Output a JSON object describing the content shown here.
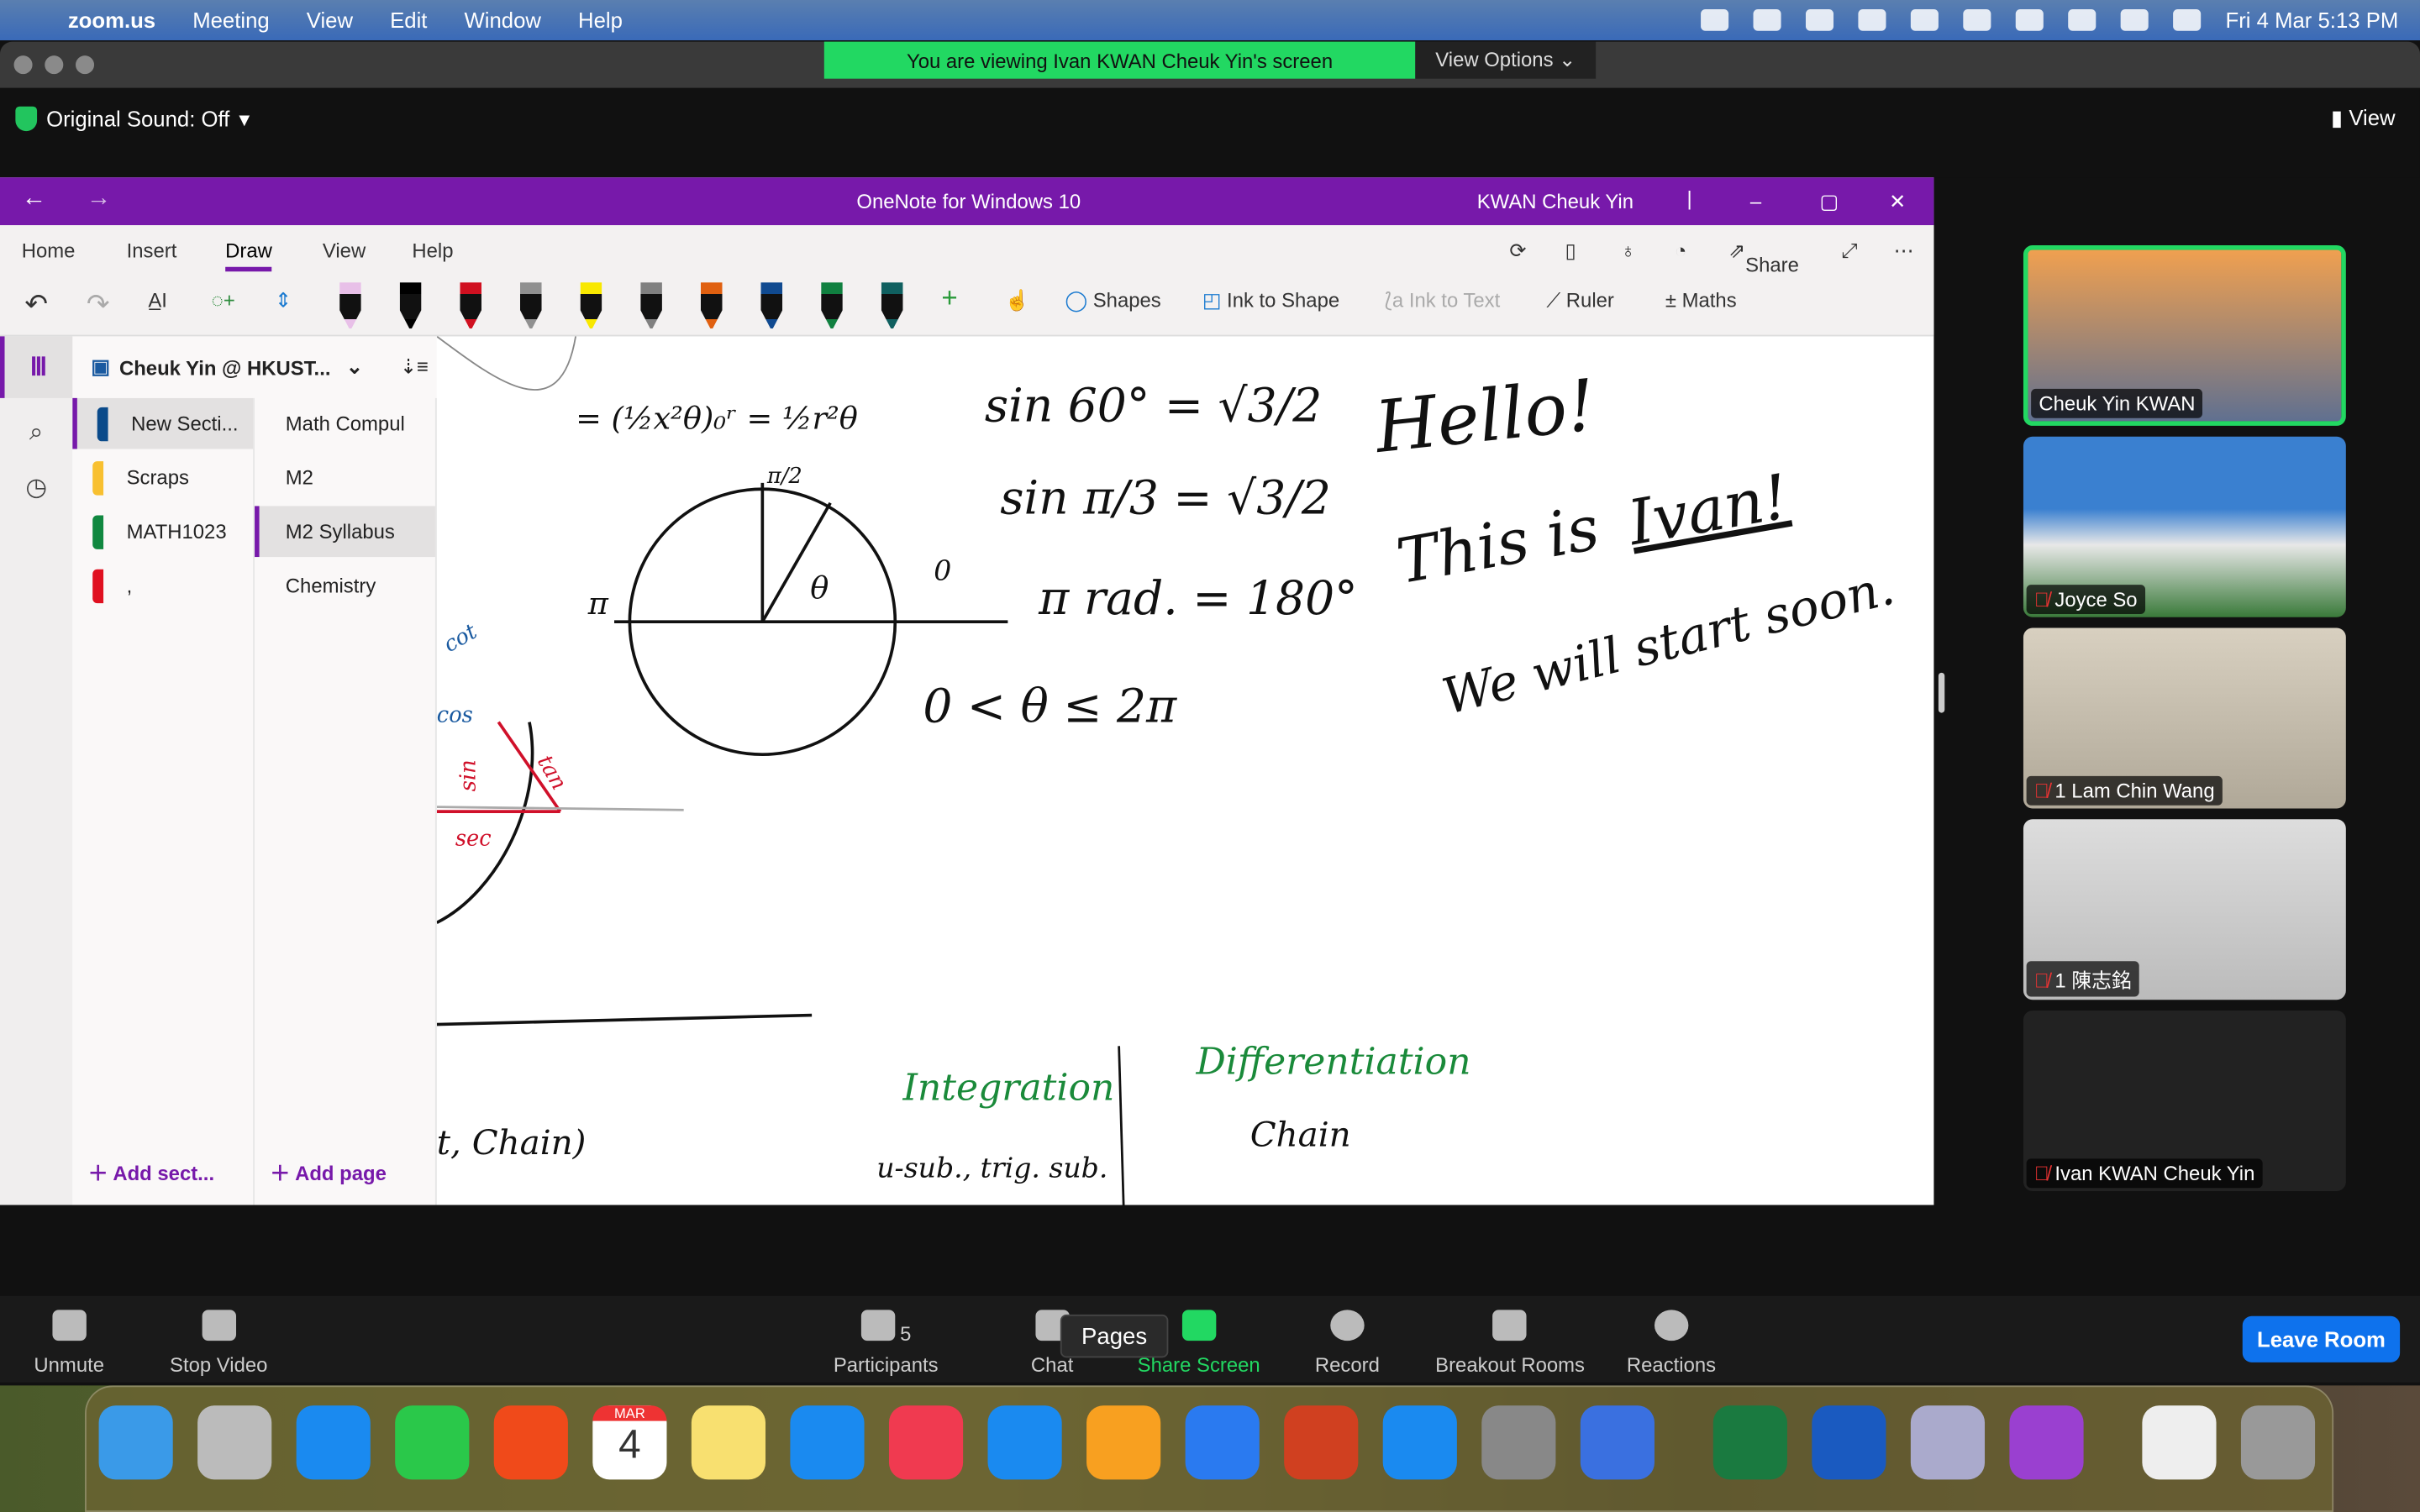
{
  "menubar": {
    "app": "zoom.us",
    "items": [
      "Meeting",
      "View",
      "Edit",
      "Window",
      "Help"
    ],
    "clock": "Fri 4 Mar  5:13 PM"
  },
  "zoom": {
    "banner": "You are viewing Ivan KWAN Cheuk Yin's screen",
    "view_options": "View Options ⌄",
    "original_sound": "Original Sound: Off",
    "view": "View"
  },
  "onenote": {
    "title": "OneNote for Windows 10",
    "user": "KWAN Cheuk Yin",
    "tabs": [
      "Home",
      "Insert",
      "Draw",
      "View",
      "Help"
    ],
    "active_tab": "Draw",
    "share": "Share",
    "tools": {
      "shapes": "Shapes",
      "ink_to_shape": "Ink to Shape",
      "ink_to_text": "Ink to Text",
      "ruler": "Ruler",
      "maths": "Maths"
    },
    "pen_colors": [
      "#e8c0e8",
      "#000000",
      "#d01020",
      "#909090",
      "#f8e800",
      "#808080",
      "#e06010",
      "#104a90",
      "#108040",
      "#106060"
    ],
    "notebook": "Cheuk Yin @ HKUST...",
    "sections": [
      {
        "label": "New Secti...",
        "color": "#0a4a8a"
      },
      {
        "label": "Scraps",
        "color": "#f8c030"
      },
      {
        "label": "MATH1023",
        "color": "#108840"
      },
      {
        "label": ",",
        "color": "#e01020"
      }
    ],
    "pages": [
      "Math Compul",
      "M2",
      "M2 Syllabus",
      "Chemistry"
    ],
    "selected_page": "M2 Syllabus",
    "add_section": "Add sect...",
    "add_page": "Add page",
    "ink": {
      "sin60": "sin 60° = √3/2",
      "sinpi3": "sin π/3 = √3/2",
      "rad": "π rad. = 180°",
      "range": "0 < θ ≤ 2π",
      "integral": "= (½x²θ)₀ʳ = ½r²θ",
      "hello": "Hello!",
      "this_is": "This is",
      "ivan": "Ivan!",
      "start": "We will start soon.",
      "integration": "Integration",
      "integration_sub": "u-sub., trig. sub.",
      "differentiation": "Differentiation",
      "chain": "Chain",
      "chain_left": "t, Chain)",
      "cot": "cot",
      "cos": "cos",
      "sin": "sin",
      "tan": "tan",
      "sec": "sec",
      "pi": "π",
      "half_pi": "π/2",
      "zero": "0",
      "theta": "θ"
    }
  },
  "participants": [
    {
      "name": "Cheuk Yin KWAN",
      "muted": false,
      "active": true
    },
    {
      "name": "Joyce So",
      "muted": true
    },
    {
      "name": "1 Lam Chin Wang",
      "muted": true
    },
    {
      "name": "1 陳志銘",
      "muted": true
    },
    {
      "name": "Ivan KWAN Cheuk Yin",
      "muted": true
    }
  ],
  "controls": {
    "unmute": "Unmute",
    "stop_video": "Stop Video",
    "participants": "Participants",
    "participants_count": "5",
    "chat": "Chat",
    "share_screen": "Share Screen",
    "record": "Record",
    "breakout": "Breakout Rooms",
    "reactions": "Reactions",
    "leave": "Leave Room",
    "tooltip": "Pages"
  },
  "dock": {
    "calendar_month": "MAR",
    "calendar_day": "4",
    "apps": [
      "finder",
      "launchpad",
      "mail",
      "messages",
      "brave",
      "calendar",
      "notes",
      "safari",
      "music",
      "keynote",
      "pages",
      "zoom",
      "anydesk",
      "app-store",
      "system-preferences",
      "signal",
      "excel",
      "word",
      "preview",
      "podcasts",
      "document",
      "trash"
    ]
  }
}
